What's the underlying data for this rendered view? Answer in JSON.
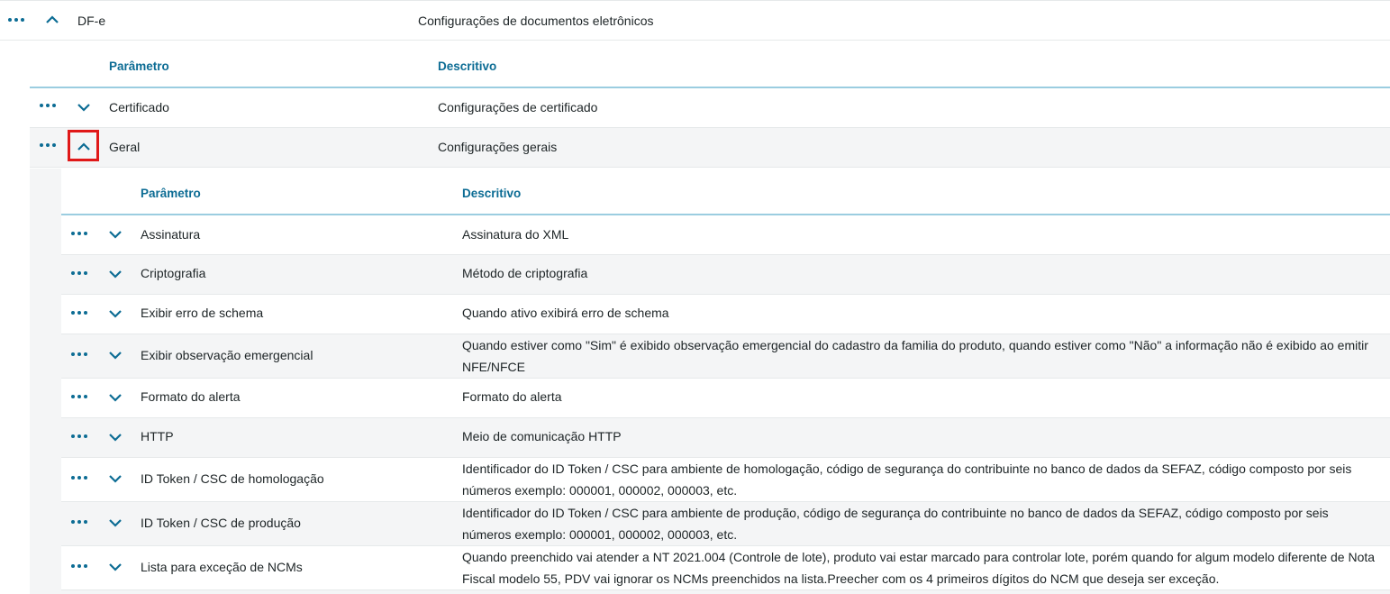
{
  "top": {
    "param": "DF-e",
    "desc": "Configurações de documentos eletrônicos"
  },
  "level1": {
    "header": {
      "param": "Parâmetro",
      "desc": "Descritivo"
    },
    "rows": [
      {
        "param": "Certificado",
        "desc": "Configurações de certificado"
      },
      {
        "param": "Geral",
        "desc": "Configurações gerais"
      }
    ]
  },
  "level2": {
    "header": {
      "param": "Parâmetro",
      "desc": "Descritivo"
    },
    "rows": [
      {
        "param": "Assinatura",
        "desc": "Assinatura do XML"
      },
      {
        "param": "Criptografia",
        "desc": "Método de criptografia"
      },
      {
        "param": "Exibir erro de schema",
        "desc": "Quando ativo exibirá erro de schema"
      },
      {
        "param": "Exibir observação emergencial",
        "desc": "Quando estiver como \"Sim\" é exibido observação emergencial do cadastro da familia do produto, quando estiver como \"Não\" a informação não é exibido ao emitir NFE/NFCE"
      },
      {
        "param": "Formato do alerta",
        "desc": "Formato do alerta"
      },
      {
        "param": "HTTP",
        "desc": "Meio de comunicação HTTP"
      },
      {
        "param": "ID Token / CSC de homologação",
        "desc": "Identificador do ID Token / CSC para ambiente de homologação, código de segurança do contribuinte no banco de dados da SEFAZ, código composto por seis números exemplo: 000001, 000002, 000003, etc."
      },
      {
        "param": "ID Token / CSC de produção",
        "desc": "Identificador do ID Token / CSC para ambiente de produção, código de segurança do contribuinte no banco de dados da SEFAZ, código composto por seis números exemplo: 000001, 000002, 000003, etc."
      },
      {
        "param": "Lista para exceção de NCMs",
        "desc": "Quando preenchido vai atender a NT 2021.004 (Controle de lote), produto vai estar marcado para controlar lote, porém quando for algum modelo diferente de Nota Fiscal modelo 55, PDV vai ignorar os NCMs preenchidos na lista.Preecher com os 4 primeiros dígitos do NCM que deseja ser exceção."
      }
    ]
  },
  "colors": {
    "accent": "#0c6c94",
    "highlight": "#e01818",
    "row_alt": "#f4f5f6"
  }
}
